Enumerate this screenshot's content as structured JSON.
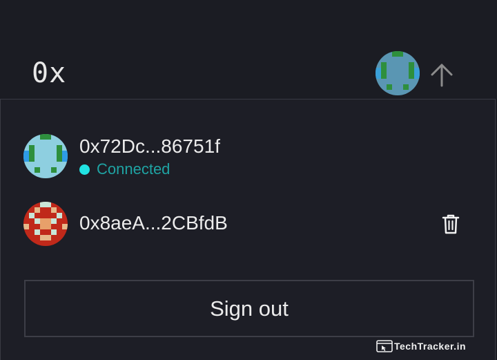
{
  "header": {
    "brand": "0x",
    "avatar_icon": "identicon-avatar",
    "arrow_icon": "arrow-up-icon"
  },
  "accounts": [
    {
      "address": "0x72Dc...86751f",
      "status": "Connected",
      "status_color": "#21e3e3",
      "avatar_icon": "identicon-avatar"
    },
    {
      "address": "0x8aeA...2CBfdB",
      "avatar_icon": "identicon-avatar",
      "remove_icon": "trash-icon"
    }
  ],
  "sign_out_label": "Sign out",
  "watermark": "TechTracker.in",
  "colors": {
    "background": "#1b1c23",
    "border": "#3a3b44",
    "text": "#ececec",
    "status": "#1fa3a3"
  }
}
